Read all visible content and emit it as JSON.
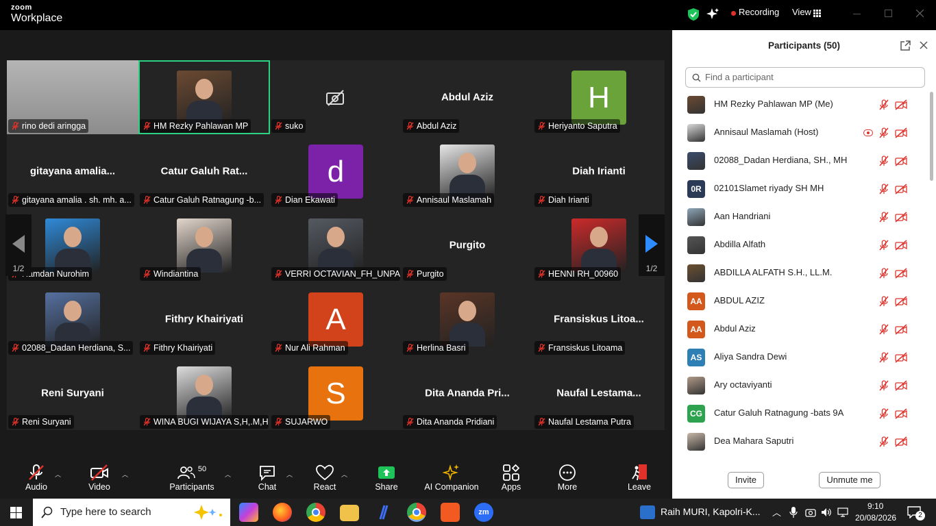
{
  "titlebar": {
    "brand_top": "zoom",
    "brand_bottom": "Workplace",
    "recording": "Recording",
    "view": "View"
  },
  "grid_tiles": [
    {
      "name": "rino dedi aringga",
      "type": "photo",
      "bg": "#9a9a9a"
    },
    {
      "name": "HM Rezky Pahlawan MP",
      "type": "photo",
      "bg": "#6b4a32",
      "active": true
    },
    {
      "name": "suko",
      "type": "camoff"
    },
    {
      "name": "Abdul Aziz",
      "type": "text",
      "big": "Abdul Aziz"
    },
    {
      "name": "Heriyanto Saputra",
      "type": "letter",
      "letter": "H",
      "color": "#6aa33a"
    },
    {
      "name": "gitayana amalia . sh. mh. a...",
      "type": "text",
      "big": "gitayana  amalia..."
    },
    {
      "name": "Catur Galuh Ratnagung -b...",
      "type": "text",
      "big": "Catur Galuh Rat..."
    },
    {
      "name": "Dian Ekawati",
      "type": "letter",
      "letter": "d",
      "color": "#7b22a8"
    },
    {
      "name": "Annisaul Maslamah",
      "type": "photo",
      "bg": "#e6e6e6"
    },
    {
      "name": "Diah Irianti",
      "type": "text",
      "big": "Diah Irianti"
    },
    {
      "name": "Hamdan Nurohim",
      "type": "photo",
      "bg": "#2f8ad8"
    },
    {
      "name": "Windiantina",
      "type": "photo",
      "bg": "#e2d6cc"
    },
    {
      "name": "VERRI OCTAVIAN_FH_UNPA...",
      "type": "photo",
      "bg": "#555a62"
    },
    {
      "name": "Purgito",
      "type": "text",
      "big": "Purgito"
    },
    {
      "name": "HENNI RH_00960",
      "type": "photo",
      "bg": "#cc2a2a"
    },
    {
      "name": "02088_Dadan Herdiana,  S...",
      "type": "photo",
      "bg": "#5570a0"
    },
    {
      "name": "Fithry Khairiyati",
      "type": "text",
      "big": "Fithry Khairiyati"
    },
    {
      "name": "Nur Ali Rahman",
      "type": "letter",
      "letter": "A",
      "color": "#d2431c"
    },
    {
      "name": "Herlina Basri",
      "type": "photo",
      "bg": "#5a3526"
    },
    {
      "name": "Fransiskus Litoama",
      "type": "text",
      "big": "Fransiskus  Litoa..."
    },
    {
      "name": "Reni Suryani",
      "type": "text",
      "big": "Reni Suryani"
    },
    {
      "name": "WINA BUGI WIJAYA S,H,.M,H.",
      "type": "photo",
      "bg": "#dcdcdc"
    },
    {
      "name": "SUJARWO",
      "type": "letter",
      "letter": "S",
      "color": "#e8730e"
    },
    {
      "name": "Dita Ananda Pridiani",
      "type": "text",
      "big": "Dita Ananda Pri..."
    },
    {
      "name": "Naufal Lestama Putra",
      "type": "text",
      "big": "Naufal  Lestama..."
    }
  ],
  "pager": {
    "left": "1/2",
    "right": "1/2"
  },
  "toolbar": {
    "audio": "Audio",
    "video": "Video",
    "participants": "Participants",
    "participants_count": "50",
    "chat": "Chat",
    "react": "React",
    "share": "Share",
    "ai": "AI Companion",
    "apps": "Apps",
    "more": "More",
    "leave": "Leave"
  },
  "panel": {
    "title": "Participants (50)",
    "search_placeholder": "Find a participant",
    "invite": "Invite",
    "unmute": "Unmute me"
  },
  "participants": [
    {
      "name": "HM Rezky Pahlawan MP (Me)",
      "type": "photo",
      "color": "#6b4a32"
    },
    {
      "name": "Annisaul Maslamah (Host)",
      "type": "photo",
      "color": "#d8d8d8",
      "host": true
    },
    {
      "name": "02088_Dadan Herdiana,  SH.,  MH",
      "type": "photo",
      "color": "#3b4c6c"
    },
    {
      "name": "02101Slamet riyady SH MH",
      "type": "initials",
      "initials": "0R",
      "color": "#2b3a55"
    },
    {
      "name": "Aan Handriani",
      "type": "photo",
      "color": "#8ea6b8"
    },
    {
      "name": "Abdilla Alfath",
      "type": "photo",
      "color": "#555"
    },
    {
      "name": "ABDILLA ALFATH S.H., LL.M.",
      "type": "photo",
      "color": "#6b5030"
    },
    {
      "name": "ABDUL AZIZ",
      "type": "initials",
      "initials": "AA",
      "color": "#d3581c"
    },
    {
      "name": "Abdul Aziz",
      "type": "initials",
      "initials": "AA",
      "color": "#d3581c"
    },
    {
      "name": "Aliya Sandra Dewi",
      "type": "initials",
      "initials": "AS",
      "color": "#2e7fb3"
    },
    {
      "name": "Ary octaviyanti",
      "type": "photo",
      "color": "#b09a88"
    },
    {
      "name": "Catur Galuh Ratnagung -bats 9A",
      "type": "initials",
      "initials": "CG",
      "color": "#2ea34f"
    },
    {
      "name": "Dea Mahara Saputri",
      "type": "photo",
      "color": "#c8b8a8"
    }
  ],
  "taskbar": {
    "search": "Type here to search",
    "news": "Raih MURI, Kapolri-K...",
    "time": "9:10",
    "date": "20/08/2026",
    "notif": "2"
  },
  "colors": {
    "muted": "#e0322b",
    "active_outline": "#2dd383",
    "share": "#1ec35a"
  }
}
